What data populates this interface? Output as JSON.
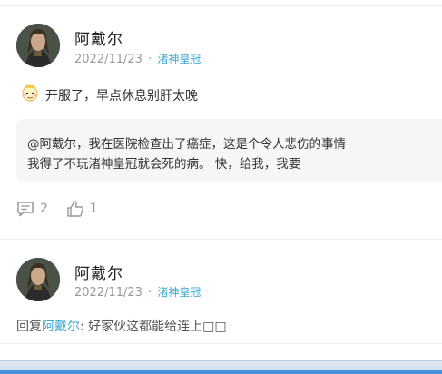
{
  "comment": {
    "author": "阿戴尔",
    "date": "2022/11/23",
    "separator": "·",
    "board": "渚神皇冠",
    "text": "开服了，早点休息别肝太晚",
    "emoji_icon": "cartoon-face-icon",
    "quote_lines": [
      "@阿戴尔，我在医院检查出了癌症，这是个令人悲伤的事情",
      "我得了不玩渚神皇冠就会死的病。 快，给我，我要"
    ],
    "reply_count": "2",
    "like_count": "1",
    "reply_icon": "comment-icon",
    "like_icon": "thumbs-up-icon"
  },
  "reply": {
    "author": "阿戴尔",
    "date": "2022/11/23",
    "separator": "·",
    "board": "渚神皇冠",
    "prefix": "回复",
    "mention": "阿戴尔",
    "text": ": 好家伙这都能给连上□□"
  },
  "colors": {
    "link": "#3fa9d5",
    "meta": "#999999",
    "quote_bg": "#f5f6f8"
  }
}
